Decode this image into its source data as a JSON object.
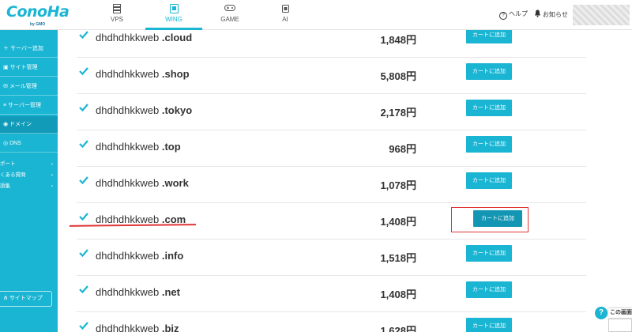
{
  "header": {
    "logo_text": "ConoHa",
    "logo_sub": "by GMO",
    "tabs": [
      {
        "label": "VPS",
        "icon": "server-icon"
      },
      {
        "label": "WING",
        "icon": "wing-icon"
      },
      {
        "label": "GAME",
        "icon": "gamepad-icon"
      },
      {
        "label": "AI",
        "icon": "ai-icon"
      }
    ],
    "help_label": "ヘルプ",
    "notice_label": "お知らせ"
  },
  "sidebar": {
    "items": [
      {
        "label": "サーバー追加",
        "icon": "plus-icon"
      },
      {
        "label": "サイト管理",
        "icon": "site-icon"
      },
      {
        "label": "メール管理",
        "icon": "mail-icon"
      },
      {
        "label": "サーバー管理",
        "icon": "server-icon"
      },
      {
        "label": "ドメイン",
        "icon": "domain-icon",
        "active": true
      },
      {
        "label": "DNS",
        "icon": "dns-icon"
      }
    ],
    "sub_items": [
      {
        "label": "ポート"
      },
      {
        "label": "くある質問"
      },
      {
        "label": "語集"
      }
    ],
    "sitemap_label": "サイトマップ"
  },
  "domains": {
    "cart_label": "カートに追加",
    "rows": [
      {
        "name": "dhdhdhkkweb",
        "tld": ".cloud",
        "price": "1,848円"
      },
      {
        "name": "dhdhdhkkweb",
        "tld": ".shop",
        "price": "5,808円"
      },
      {
        "name": "dhdhdhkkweb",
        "tld": ".tokyo",
        "price": "2,178円"
      },
      {
        "name": "dhdhdhkkweb",
        "tld": ".top",
        "price": "968円"
      },
      {
        "name": "dhdhdhkkweb",
        "tld": ".work",
        "price": "1,078円"
      },
      {
        "name": "dhdhdhkkweb",
        "tld": ".com",
        "price": "1,408円",
        "highlighted": true
      },
      {
        "name": "dhdhdhkkweb",
        "tld": ".info",
        "price": "1,518円"
      },
      {
        "name": "dhdhdhkkweb",
        "tld": ".net",
        "price": "1,408円"
      },
      {
        "name": "dhdhdhkkweb",
        "tld": ".biz",
        "price": "1,628円"
      }
    ]
  },
  "help_widget": {
    "label": "この画面"
  },
  "colors": {
    "accent": "#19b5d3",
    "highlight": "#e03535"
  }
}
